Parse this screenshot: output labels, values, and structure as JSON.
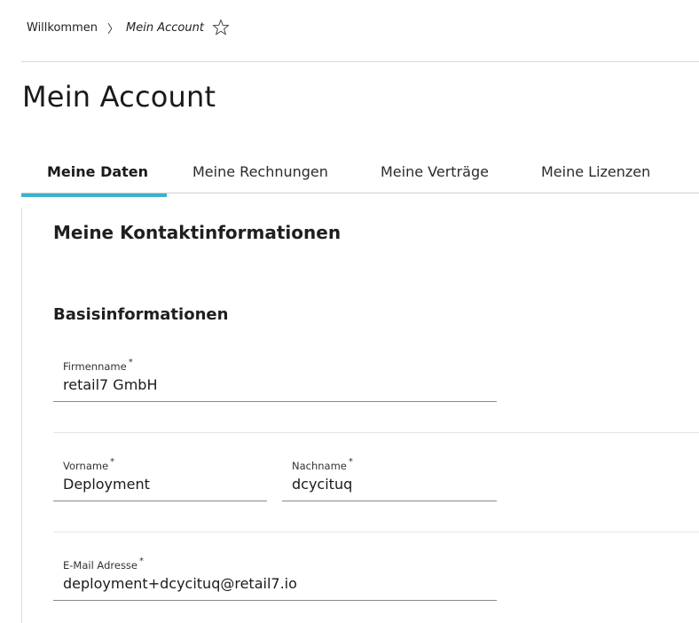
{
  "breadcrumb": {
    "home": "Willkommen",
    "separator": "〉",
    "current": "Mein Account"
  },
  "page_title": "Mein Account",
  "tabs": [
    {
      "label": "Meine Daten",
      "active": true
    },
    {
      "label": "Meine Rechnungen",
      "active": false
    },
    {
      "label": "Meine Verträge",
      "active": false
    },
    {
      "label": "Meine Lizenzen",
      "active": false
    }
  ],
  "section_title": "Meine Kontaktinformationen",
  "subsection_title": "Basisinformationen",
  "required_marker": "*",
  "fields": {
    "company": {
      "label": "Firmenname",
      "value": "retail7 GmbH"
    },
    "firstname": {
      "label": "Vorname",
      "value": "Deployment"
    },
    "lastname": {
      "label": "Nachname",
      "value": "dcycituq"
    },
    "email": {
      "label": "E-Mail Adresse",
      "value": "deployment+dcycituq@retail7.io"
    }
  },
  "colors": {
    "accent": "#36b3cf",
    "divider": "#d8d8d8",
    "input_underline": "#8a8a8a"
  },
  "icons": {
    "favorite": "star-outline-icon"
  }
}
